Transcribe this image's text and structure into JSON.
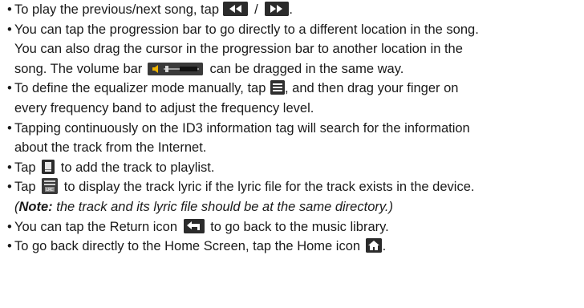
{
  "bullet": "•",
  "items": [
    {
      "pre": "To play the previous/next song, tap ",
      "icon1": "prev-icon",
      "sep": " / ",
      "icon2": "next-icon",
      "post": "."
    },
    {
      "l1": "You can tap the progression bar to go directly to a different location in the song.",
      "l2": "You can also drag the cursor in the progression bar to another location in the",
      "l3pre": "song. The volume bar ",
      "icon": "volume-bar-icon",
      "l3post": " can be dragged in the same way."
    },
    {
      "l1pre": "To define the equalizer mode manually, tap ",
      "icon": "equalizer-icon",
      "l1post": ", and then drag your finger on",
      "l2": "every frequency band to adjust the frequency level."
    },
    {
      "l1": "Tapping continuously on the ID3 information tag will search for the information",
      "l2": "about the track from the Internet."
    },
    {
      "pre": "Tap ",
      "icon": "add-to-playlist-icon",
      "post": " to add the track to playlist."
    },
    {
      "pre": "Tap ",
      "icon": "lyrics-icon",
      "post": " to display the track lyric if the lyric file for the track exists in the device.",
      "note_open": "(",
      "note_label": "Note:",
      "note_text": " the track and its lyric file should be at the same directory.)"
    },
    {
      "pre": "You can tap the Return icon ",
      "icon": "return-icon",
      "post": " to go back to the music library."
    },
    {
      "pre": "To go back directly to the Home Screen, tap the Home icon ",
      "icon": "home-icon",
      "post": "."
    }
  ]
}
